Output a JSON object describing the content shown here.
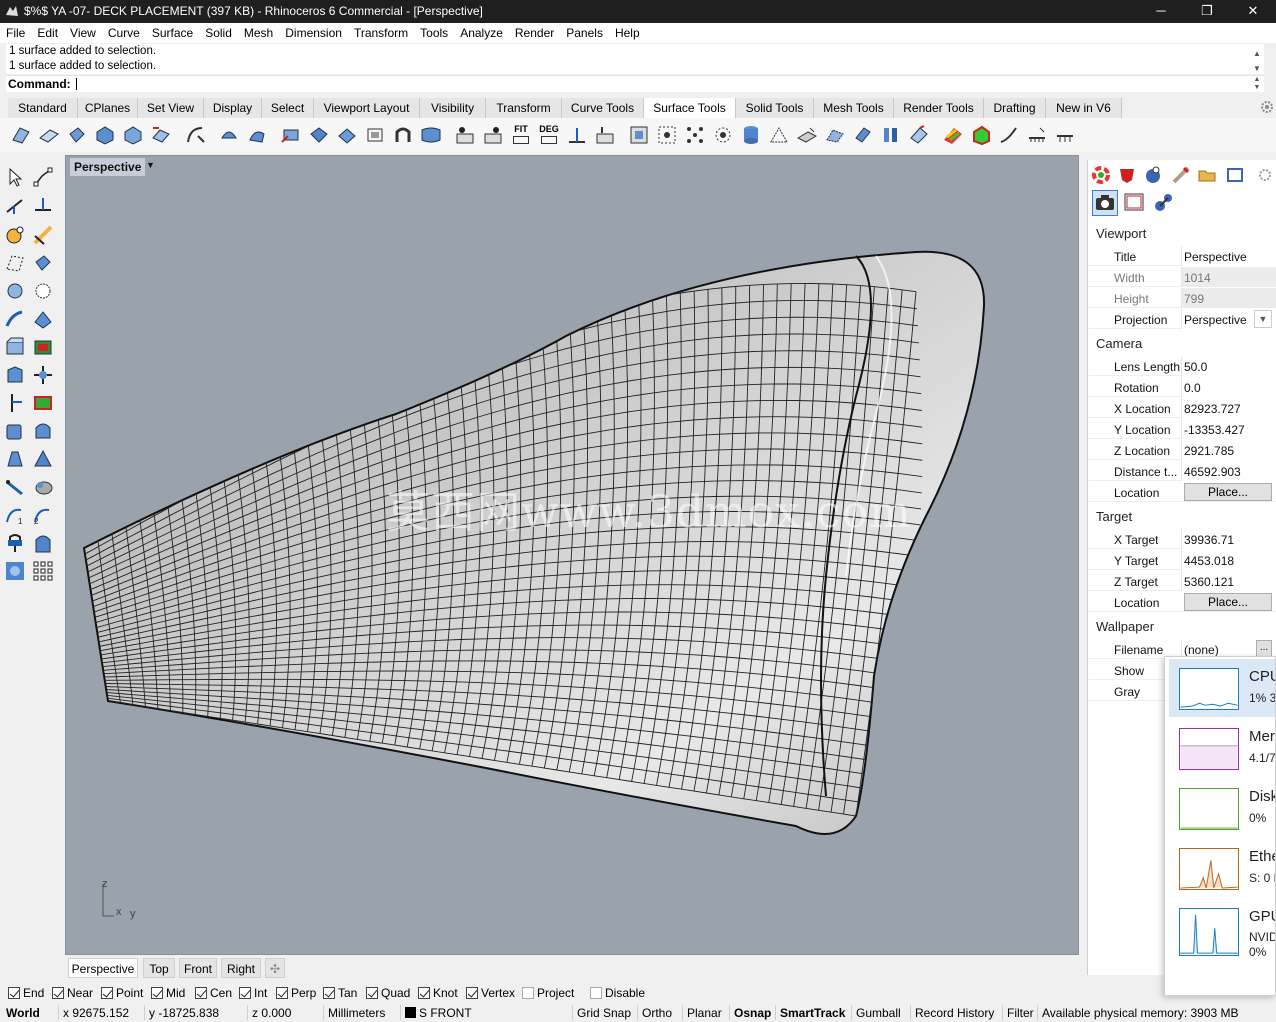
{
  "window": {
    "title": "$%$  YA -07- DECK PLACEMENT (397 KB) - Rhinoceros 6 Commercial - [Perspective]",
    "minimize": "─",
    "restore": "❐",
    "close": "✕"
  },
  "menu": [
    "File",
    "Edit",
    "View",
    "Curve",
    "Surface",
    "Solid",
    "Mesh",
    "Dimension",
    "Transform",
    "Tools",
    "Analyze",
    "Render",
    "Panels",
    "Help"
  ],
  "history": [
    "1 surface added to selection.",
    "1 surface added to selection."
  ],
  "command": {
    "label": "Command:",
    "value": ""
  },
  "toolbar_tabs": [
    {
      "label": "Standard",
      "active": false
    },
    {
      "label": "CPlanes",
      "active": false
    },
    {
      "label": "Set View",
      "active": false
    },
    {
      "label": "Display",
      "active": false
    },
    {
      "label": "Select",
      "active": false
    },
    {
      "label": "Viewport Layout",
      "active": false
    },
    {
      "label": "Visibility",
      "active": false
    },
    {
      "label": "Transform",
      "active": false
    },
    {
      "label": "Curve Tools",
      "active": false
    },
    {
      "label": "Surface Tools",
      "active": true
    },
    {
      "label": "Solid Tools",
      "active": false
    },
    {
      "label": "Mesh Tools",
      "active": false
    },
    {
      "label": "Render Tools",
      "active": false
    },
    {
      "label": "Drafting",
      "active": false
    },
    {
      "label": "New in V6",
      "active": false
    }
  ],
  "toolbar_icons": {
    "fit": "FIT",
    "deg": "DEG"
  },
  "viewport": {
    "title": "Perspective",
    "watermark": "莫西网www.3dmox.com",
    "axes": {
      "z": "z",
      "x": "x",
      "y": "y"
    }
  },
  "viewport_tabs": [
    "Perspective",
    "Top",
    "Front",
    "Right"
  ],
  "viewport_tab_add": "✣",
  "properties": {
    "viewport_header": "Viewport",
    "title_label": "Title",
    "title_value": "Perspective",
    "width_label": "Width",
    "width_value": "1014",
    "height_label": "Height",
    "height_value": "799",
    "projection_label": "Projection",
    "projection_value": "Perspective",
    "camera_header": "Camera",
    "lens_label": "Lens Length",
    "lens_value": "50.0",
    "rotation_label": "Rotation",
    "rotation_value": "0.0",
    "xloc_label": "X Location",
    "xloc_value": "82923.727",
    "yloc_label": "Y Location",
    "yloc_value": "-13353.427",
    "zloc_label": "Z Location",
    "zloc_value": "2921.785",
    "dist_label": "Distance t...",
    "dist_value": "46592.903",
    "cam_location_label": "Location",
    "cam_place": "Place...",
    "target_header": "Target",
    "xt_label": "X Target",
    "xt_value": "39936.71",
    "yt_label": "Y Target",
    "yt_value": "4453.018",
    "zt_label": "Z Target",
    "zt_value": "5360.121",
    "tgt_location_label": "Location",
    "tgt_place": "Place...",
    "wallpaper_header": "Wallpaper",
    "filename_label": "Filename",
    "filename_value": "(none)",
    "filename_btn": "...",
    "show_label": "Show",
    "gray_label": "Gray"
  },
  "taskmgr": [
    {
      "name": "CPU",
      "value": "1% 3",
      "color": "#1a7bc2"
    },
    {
      "name": "Mer",
      "value": "4.1/7",
      "color": "#9b2fae"
    },
    {
      "name": "Disk",
      "value": "0%",
      "color": "#4ba22e"
    },
    {
      "name": "Ethe",
      "value": "S: 0 F",
      "color": "#b5651d"
    },
    {
      "name": "GPU",
      "value": "NVID",
      "value2": "0%",
      "color": "#1a7bc2"
    }
  ],
  "osnaps": [
    {
      "label": "End",
      "on": true
    },
    {
      "label": "Near",
      "on": true
    },
    {
      "label": "Point",
      "on": true
    },
    {
      "label": "Mid",
      "on": true
    },
    {
      "label": "Cen",
      "on": true
    },
    {
      "label": "Int",
      "on": true
    },
    {
      "label": "Perp",
      "on": true
    },
    {
      "label": "Tan",
      "on": true
    },
    {
      "label": "Quad",
      "on": true
    },
    {
      "label": "Knot",
      "on": true
    },
    {
      "label": "Vertex",
      "on": true
    },
    {
      "label": "Project",
      "on": false
    },
    {
      "label": "Disable",
      "on": false
    }
  ],
  "status": {
    "cplane": "World",
    "x": "x 92675.152",
    "y": "y -18725.838",
    "z": "z 0.000",
    "units": "Millimeters",
    "layer": "S FRONT",
    "grid_snap": "Grid Snap",
    "ortho": "Ortho",
    "planar": "Planar",
    "osnap": "Osnap",
    "smarttrack": "SmartTrack",
    "gumball": "Gumball",
    "record_history": "Record History",
    "filter": "Filter",
    "memory": "Available physical memory: 3903 MB"
  }
}
